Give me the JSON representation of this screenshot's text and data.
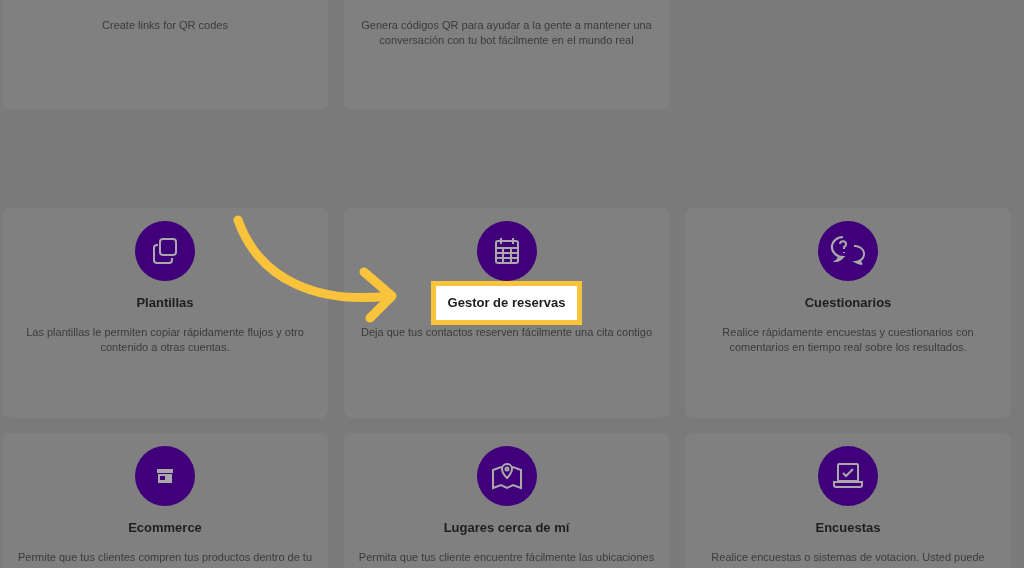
{
  "top_cards": [
    {
      "description": "Create links for QR codes"
    },
    {
      "description": "Genera códigos QR para ayudar a la gente a mantener una conversación con tu bot fácilmente en el mundo real"
    }
  ],
  "cards": [
    {
      "kind": "copy",
      "title": "Plantillas",
      "description": "Las plantillas le permiten copiar rápidamente flujos y otro contenido a otras cuentas.",
      "highlighted": false
    },
    {
      "kind": "calendar",
      "title": "Gestor de reservas",
      "description": "Deja que tus contactos reserven fácilmente una cita contigo",
      "highlighted": true
    },
    {
      "kind": "chat",
      "title": "Cuestionarios",
      "description": "Realice rápidamente encuestas y cuestionarios con comentarios en tiempo real sobre los resultados.",
      "highlighted": false
    },
    {
      "kind": "store",
      "title": "Ecommerce",
      "description": "Permite que tus clientes compren tus productos dentro de tu",
      "highlighted": false
    },
    {
      "kind": "map",
      "title": "Lugares cerca de mí",
      "description": "Permita que tus cliente encuentre fácilmente las ubicaciones",
      "highlighted": false
    },
    {
      "kind": "laptop",
      "title": "Encuestas",
      "description": "Realice encuestas o sistemas de votacion. Usted puede",
      "highlighted": false
    }
  ]
}
